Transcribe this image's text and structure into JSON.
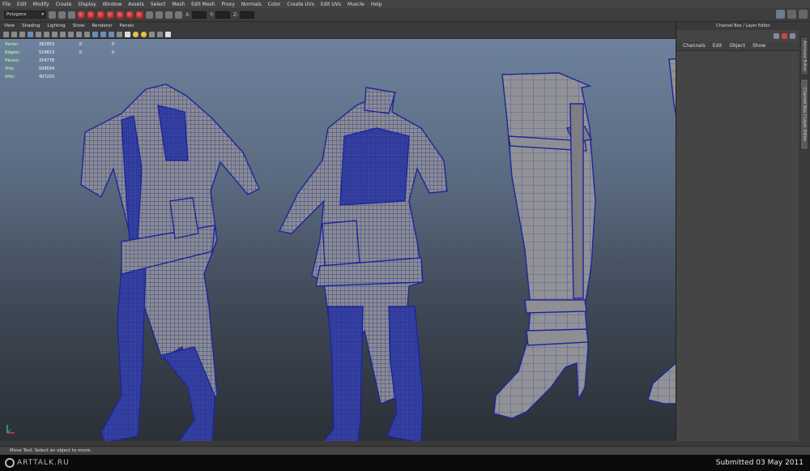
{
  "menubar": {
    "items": [
      "File",
      "Edit",
      "Modify",
      "Create",
      "Display",
      "Window",
      "Assets",
      "Select",
      "Mesh",
      "Edit Mesh",
      "Proxy",
      "Normals",
      "Color",
      "Create UVs",
      "Edit UVs",
      "Muscle",
      "Help"
    ]
  },
  "toolbar": {
    "mode": "Polygons",
    "field_labels": [
      "X:",
      "Y:",
      "Z:"
    ]
  },
  "viewport_menu": {
    "items": [
      "View",
      "Shading",
      "Lighting",
      "Show",
      "Renderer",
      "Panels"
    ]
  },
  "hud": {
    "rows": [
      {
        "label": "Verts:",
        "value": "262953",
        "a": "0",
        "b": "0"
      },
      {
        "label": "Edges:",
        "value": "519813",
        "a": "0",
        "b": "0"
      },
      {
        "label": "Faces:",
        "value": "254778",
        "a": "",
        "b": ""
      },
      {
        "label": "Tris:",
        "value": "509554",
        "a": "",
        "b": ""
      },
      {
        "label": "UVs:",
        "value": "407203",
        "a": "",
        "b": ""
      }
    ]
  },
  "channel_box": {
    "title": "Channel Box / Layer Editor",
    "tabs": [
      "Channels",
      "Edit",
      "Object",
      "Show"
    ],
    "side_tabs": [
      "Attribute Editor",
      "Channel Box / Layer Editor"
    ]
  },
  "status": {
    "help_text": "Move Tool: Select an object to move."
  },
  "footer": {
    "logo": "ARTTALK.RU",
    "submitted": "Submitted 03 May 2011"
  },
  "colors": {
    "wire": "#1e2aa8",
    "mesh": "#8a8a8e",
    "viewport_top": "#6e819d",
    "viewport_bottom": "#2b3037"
  }
}
